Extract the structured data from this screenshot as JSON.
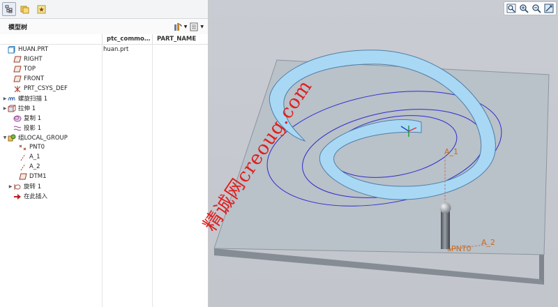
{
  "model_tree": {
    "panel_title": "模型树",
    "columns": [
      "ptc_commo…",
      "PART_NAME"
    ],
    "root_value": "huan.prt",
    "items": [
      {
        "label": "HUAN.PRT",
        "icon": "part-icon",
        "expander": ""
      },
      {
        "label": "RIGHT",
        "icon": "datum-plane-icon",
        "expander": ""
      },
      {
        "label": "TOP",
        "icon": "datum-plane-icon",
        "expander": ""
      },
      {
        "label": "FRONT",
        "icon": "datum-plane-icon",
        "expander": ""
      },
      {
        "label": "PRT_CSYS_DEF",
        "icon": "csys-icon",
        "expander": ""
      },
      {
        "label": "螺旋扫描 1",
        "icon": "helical-sweep-icon",
        "expander": "▶"
      },
      {
        "label": "拉伸 1",
        "icon": "extrude-icon",
        "expander": "▶"
      },
      {
        "label": "复制 1",
        "icon": "copy-icon",
        "expander": ""
      },
      {
        "label": "投影 1",
        "icon": "projection-icon",
        "expander": ""
      },
      {
        "label": "组LOCAL_GROUP",
        "icon": "group-icon",
        "expander": "▼"
      },
      {
        "label": "PNT0",
        "icon": "datum-point-icon",
        "expander": ""
      },
      {
        "label": "A_1",
        "icon": "datum-axis-icon",
        "expander": ""
      },
      {
        "label": "A_2",
        "icon": "datum-axis-icon",
        "expander": ""
      },
      {
        "label": "DTM1",
        "icon": "datum-plane-icon",
        "expander": ""
      },
      {
        "label": "旋转 1",
        "icon": "revolve-icon",
        "expander": "▶"
      },
      {
        "label": "在此插入",
        "icon": "insert-here-arrow-icon",
        "expander": ""
      }
    ]
  },
  "viewport": {
    "labels": {
      "axis_a1": "A_1",
      "axis_a2": "A_2",
      "point": "PNT0"
    },
    "watermark": "精诚网creoug.com"
  },
  "colors": {
    "spiral_fill": "#a9d8f5",
    "plate": "#b9c1c9",
    "curve": "#2c2ccc",
    "label": "#c96a1e",
    "watermark": "#e02020"
  }
}
